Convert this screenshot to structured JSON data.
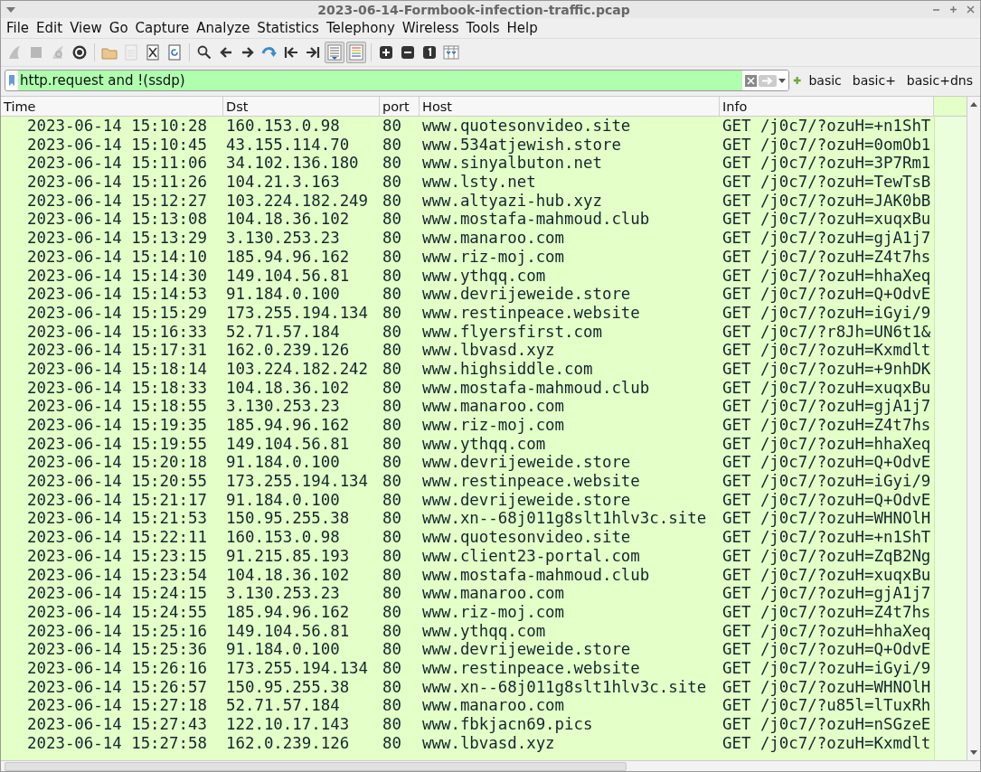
{
  "window": {
    "title": "2023-06-14-Formbook-infection-traffic.pcap"
  },
  "menu": [
    "File",
    "Edit",
    "View",
    "Go",
    "Capture",
    "Analyze",
    "Statistics",
    "Telephony",
    "Wireless",
    "Tools",
    "Help"
  ],
  "toolbar": [
    {
      "kind": "fin",
      "disabled": true,
      "pressed": false
    },
    {
      "kind": "stop",
      "disabled": true,
      "pressed": false
    },
    {
      "kind": "restart",
      "disabled": true,
      "pressed": false
    },
    {
      "kind": "gear",
      "disabled": false,
      "pressed": false
    },
    {
      "kind": "sep"
    },
    {
      "kind": "folder",
      "disabled": false,
      "pressed": false
    },
    {
      "kind": "file",
      "disabled": true,
      "pressed": false
    },
    {
      "kind": "close-file",
      "disabled": false,
      "pressed": false
    },
    {
      "kind": "reload",
      "disabled": false,
      "pressed": false
    },
    {
      "kind": "sep"
    },
    {
      "kind": "search",
      "disabled": false,
      "pressed": false
    },
    {
      "kind": "back",
      "disabled": false,
      "pressed": false
    },
    {
      "kind": "forward",
      "disabled": false,
      "pressed": false
    },
    {
      "kind": "jump",
      "disabled": false,
      "pressed": false
    },
    {
      "kind": "first",
      "disabled": false,
      "pressed": false
    },
    {
      "kind": "last",
      "disabled": false,
      "pressed": false
    },
    {
      "kind": "autoscroll",
      "disabled": false,
      "pressed": true
    },
    {
      "kind": "colorize",
      "disabled": false,
      "pressed": true
    },
    {
      "kind": "sep"
    },
    {
      "kind": "zoom-in",
      "disabled": false,
      "pressed": false
    },
    {
      "kind": "zoom-out",
      "disabled": false,
      "pressed": false
    },
    {
      "kind": "zoom-reset",
      "disabled": false,
      "pressed": false
    },
    {
      "kind": "columns",
      "disabled": false,
      "pressed": false
    }
  ],
  "filter": {
    "value": "http.request and !(ssdp)",
    "valid": true,
    "buttons": [
      "basic",
      "basic+",
      "basic+dns"
    ]
  },
  "table": {
    "columns": [
      "Time",
      "Dst",
      "port",
      "Host",
      "Info"
    ],
    "rows": [
      [
        "2023-06-14 15:10:28",
        "160.153.0.98",
        "80",
        "www.quotesonvideo.site",
        "GET /j0c7/?ozuH=+n1ShT"
      ],
      [
        "2023-06-14 15:10:45",
        "43.155.114.70",
        "80",
        "www.534atjewish.store",
        "GET /j0c7/?ozuH=0omOb1"
      ],
      [
        "2023-06-14 15:11:06",
        "34.102.136.180",
        "80",
        "www.sinyalbuton.net",
        "GET /j0c7/?ozuH=3P7Rm1"
      ],
      [
        "2023-06-14 15:11:26",
        "104.21.3.163",
        "80",
        "www.lsty.net",
        "GET /j0c7/?ozuH=TewTsB"
      ],
      [
        "2023-06-14 15:12:27",
        "103.224.182.249",
        "80",
        "www.altyazi-hub.xyz",
        "GET /j0c7/?ozuH=JAK0bB"
      ],
      [
        "2023-06-14 15:13:08",
        "104.18.36.102",
        "80",
        "www.mostafa-mahmoud.club",
        "GET /j0c7/?ozuH=xuqxBu"
      ],
      [
        "2023-06-14 15:13:29",
        "3.130.253.23",
        "80",
        "www.manaroo.com",
        "GET /j0c7/?ozuH=gjA1j7"
      ],
      [
        "2023-06-14 15:14:10",
        "185.94.96.162",
        "80",
        "www.riz-moj.com",
        "GET /j0c7/?ozuH=Z4t7hs"
      ],
      [
        "2023-06-14 15:14:30",
        "149.104.56.81",
        "80",
        "www.ythqq.com",
        "GET /j0c7/?ozuH=hhaXeq"
      ],
      [
        "2023-06-14 15:14:53",
        "91.184.0.100",
        "80",
        "www.devrijeweide.store",
        "GET /j0c7/?ozuH=Q+OdvE"
      ],
      [
        "2023-06-14 15:15:29",
        "173.255.194.134",
        "80",
        "www.restinpeace.website",
        "GET /j0c7/?ozuH=iGyi/9"
      ],
      [
        "2023-06-14 15:16:33",
        "52.71.57.184",
        "80",
        "www.flyersfirst.com",
        "GET /j0c7/?r8Jh=UN6t1&"
      ],
      [
        "2023-06-14 15:17:31",
        "162.0.239.126",
        "80",
        "www.lbvasd.xyz",
        "GET /j0c7/?ozuH=Kxmdlt"
      ],
      [
        "2023-06-14 15:18:14",
        "103.224.182.242",
        "80",
        "www.highsiddle.com",
        "GET /j0c7/?ozuH=+9nhDK"
      ],
      [
        "2023-06-14 15:18:33",
        "104.18.36.102",
        "80",
        "www.mostafa-mahmoud.club",
        "GET /j0c7/?ozuH=xuqxBu"
      ],
      [
        "2023-06-14 15:18:55",
        "3.130.253.23",
        "80",
        "www.manaroo.com",
        "GET /j0c7/?ozuH=gjA1j7"
      ],
      [
        "2023-06-14 15:19:35",
        "185.94.96.162",
        "80",
        "www.riz-moj.com",
        "GET /j0c7/?ozuH=Z4t7hs"
      ],
      [
        "2023-06-14 15:19:55",
        "149.104.56.81",
        "80",
        "www.ythqq.com",
        "GET /j0c7/?ozuH=hhaXeq"
      ],
      [
        "2023-06-14 15:20:18",
        "91.184.0.100",
        "80",
        "www.devrijeweide.store",
        "GET /j0c7/?ozuH=Q+OdvE"
      ],
      [
        "2023-06-14 15:20:55",
        "173.255.194.134",
        "80",
        "www.restinpeace.website",
        "GET /j0c7/?ozuH=iGyi/9"
      ],
      [
        "2023-06-14 15:21:17",
        "91.184.0.100",
        "80",
        "www.devrijeweide.store",
        "GET /j0c7/?ozuH=Q+OdvE"
      ],
      [
        "2023-06-14 15:21:53",
        "150.95.255.38",
        "80",
        "www.xn--68j011g8slt1hlv3c.site",
        "GET /j0c7/?ozuH=WHNOlH"
      ],
      [
        "2023-06-14 15:22:11",
        "160.153.0.98",
        "80",
        "www.quotesonvideo.site",
        "GET /j0c7/?ozuH=+n1ShT"
      ],
      [
        "2023-06-14 15:23:15",
        "91.215.85.193",
        "80",
        "www.client23-portal.com",
        "GET /j0c7/?ozuH=ZqB2Ng"
      ],
      [
        "2023-06-14 15:23:54",
        "104.18.36.102",
        "80",
        "www.mostafa-mahmoud.club",
        "GET /j0c7/?ozuH=xuqxBu"
      ],
      [
        "2023-06-14 15:24:15",
        "3.130.253.23",
        "80",
        "www.manaroo.com",
        "GET /j0c7/?ozuH=gjA1j7"
      ],
      [
        "2023-06-14 15:24:55",
        "185.94.96.162",
        "80",
        "www.riz-moj.com",
        "GET /j0c7/?ozuH=Z4t7hs"
      ],
      [
        "2023-06-14 15:25:16",
        "149.104.56.81",
        "80",
        "www.ythqq.com",
        "GET /j0c7/?ozuH=hhaXeq"
      ],
      [
        "2023-06-14 15:25:36",
        "91.184.0.100",
        "80",
        "www.devrijeweide.store",
        "GET /j0c7/?ozuH=Q+OdvE"
      ],
      [
        "2023-06-14 15:26:16",
        "173.255.194.134",
        "80",
        "www.restinpeace.website",
        "GET /j0c7/?ozuH=iGyi/9"
      ],
      [
        "2023-06-14 15:26:57",
        "150.95.255.38",
        "80",
        "www.xn--68j011g8slt1hlv3c.site",
        "GET /j0c7/?ozuH=WHNOlH"
      ],
      [
        "2023-06-14 15:27:18",
        "52.71.57.184",
        "80",
        "www.manaroo.com",
        "GET /j0c7/?u85l=lTuxRh"
      ],
      [
        "2023-06-14 15:27:43",
        "122.10.17.143",
        "80",
        "www.fbkjacn69.pics",
        "GET /j0c7/?ozuH=nSGzeE"
      ],
      [
        "2023-06-14 15:27:58",
        "162.0.239.126",
        "80",
        "www.lbvasd.xyz",
        "GET /j0c7/?ozuH=Kxmdlt"
      ]
    ]
  }
}
